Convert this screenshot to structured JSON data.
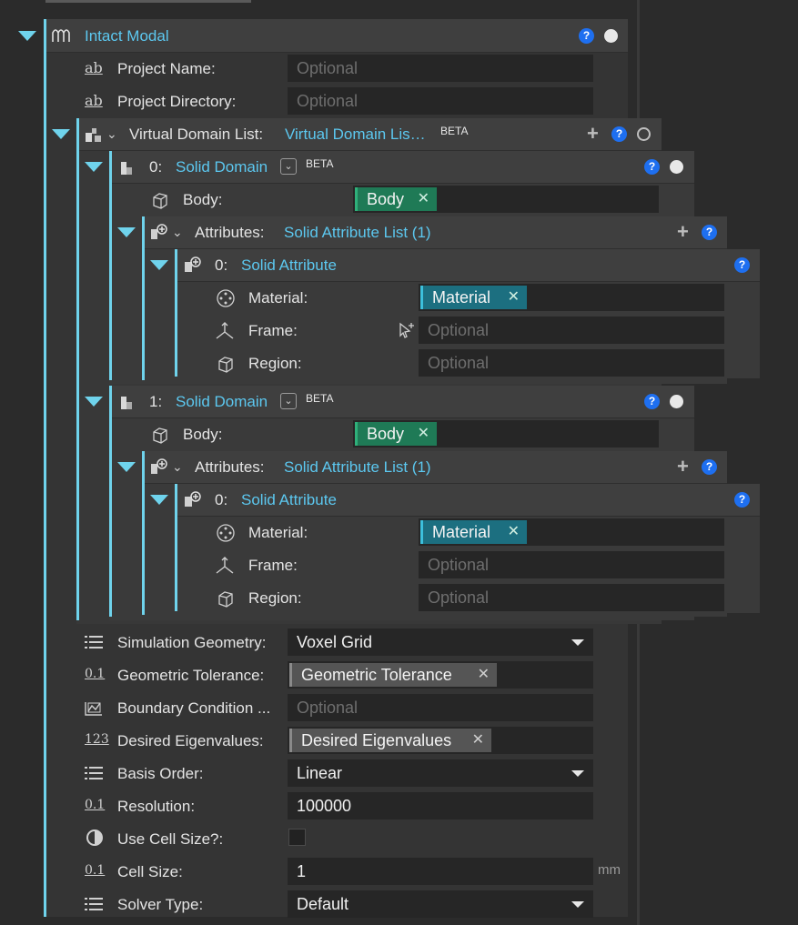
{
  "root": {
    "title": "Intact Modal",
    "project_name_label": "Project Name:",
    "project_name_placeholder": "Optional",
    "project_dir_label": "Project Directory:",
    "project_dir_placeholder": "Optional",
    "vdl_label": "Virtual Domain List:",
    "vdl_value": "Virtual Domain Lis…",
    "beta": "BETA",
    "help": "?"
  },
  "domains": [
    {
      "index": "0:",
      "title": "Solid Domain",
      "body_label": "Body:",
      "body_chip": "Body",
      "attr_label": "Attributes:",
      "attr_value": "Solid Attribute List (1)",
      "attr_index": "0:",
      "attr_title": "Solid Attribute",
      "material_label": "Material:",
      "material_chip": "Material",
      "frame_label": "Frame:",
      "frame_placeholder": "Optional",
      "region_label": "Region:",
      "region_placeholder": "Optional"
    },
    {
      "index": "1:",
      "title": "Solid Domain",
      "body_label": "Body:",
      "body_chip": "Body",
      "attr_label": "Attributes:",
      "attr_value": "Solid Attribute List (1)",
      "attr_index": "0:",
      "attr_title": "Solid Attribute",
      "material_label": "Material:",
      "material_chip": "Material",
      "frame_label": "Frame:",
      "frame_placeholder": "Optional",
      "region_label": "Region:",
      "region_placeholder": "Optional"
    }
  ],
  "settings": {
    "sim_geom_label": "Simulation Geometry:",
    "sim_geom_value": "Voxel Grid",
    "geom_tol_label": "Geometric Tolerance:",
    "geom_tol_chip": "Geometric Tolerance",
    "bc_label": "Boundary Condition ...",
    "bc_placeholder": "Optional",
    "eig_label": "Desired Eigenvalues:",
    "eig_chip": "Desired Eigenvalues",
    "basis_label": "Basis Order:",
    "basis_value": "Linear",
    "res_label": "Resolution:",
    "res_value": "100000",
    "cellsize_q_label": "Use Cell Size?:",
    "cellsize_label": "Cell Size:",
    "cellsize_value": "1",
    "cellsize_unit": "mm",
    "solver_label": "Solver Type:",
    "solver_value": "Default"
  },
  "icons": {
    "ab": "ab",
    "num": "0.1",
    "num123": "123",
    "close": "✕"
  },
  "colors": {
    "accent": "#6fd3ec",
    "body_chip": "#1f7a56",
    "material_chip": "#1c6f80",
    "value_chip": "#555555"
  }
}
